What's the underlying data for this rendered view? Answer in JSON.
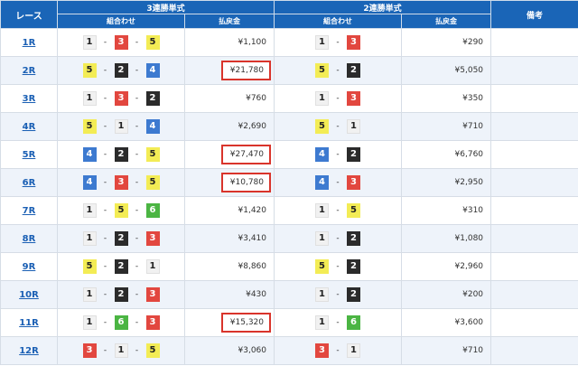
{
  "headers": {
    "race": "レース",
    "trifecta": "3連勝単式",
    "exacta": "2連勝単式",
    "note": "備考",
    "combo": "組合わせ",
    "payout": "払戻金"
  },
  "rows": [
    {
      "race": "1R",
      "tri": [
        "1",
        "3",
        "5"
      ],
      "tri_pay": "¥1,100",
      "tri_hl": false,
      "ex": [
        "1",
        "3"
      ],
      "ex_pay": "¥290"
    },
    {
      "race": "2R",
      "tri": [
        "5",
        "2",
        "4"
      ],
      "tri_pay": "¥21,780",
      "tri_hl": true,
      "ex": [
        "5",
        "2"
      ],
      "ex_pay": "¥5,050"
    },
    {
      "race": "3R",
      "tri": [
        "1",
        "3",
        "2"
      ],
      "tri_pay": "¥760",
      "tri_hl": false,
      "ex": [
        "1",
        "3"
      ],
      "ex_pay": "¥350"
    },
    {
      "race": "4R",
      "tri": [
        "5",
        "1",
        "4"
      ],
      "tri_pay": "¥2,690",
      "tri_hl": false,
      "ex": [
        "5",
        "1"
      ],
      "ex_pay": "¥710"
    },
    {
      "race": "5R",
      "tri": [
        "4",
        "2",
        "5"
      ],
      "tri_pay": "¥27,470",
      "tri_hl": true,
      "ex": [
        "4",
        "2"
      ],
      "ex_pay": "¥6,760"
    },
    {
      "race": "6R",
      "tri": [
        "4",
        "3",
        "5"
      ],
      "tri_pay": "¥10,780",
      "tri_hl": true,
      "ex": [
        "4",
        "3"
      ],
      "ex_pay": "¥2,950"
    },
    {
      "race": "7R",
      "tri": [
        "1",
        "5",
        "6"
      ],
      "tri_pay": "¥1,420",
      "tri_hl": false,
      "ex": [
        "1",
        "5"
      ],
      "ex_pay": "¥310"
    },
    {
      "race": "8R",
      "tri": [
        "1",
        "2",
        "3"
      ],
      "tri_pay": "¥3,410",
      "tri_hl": false,
      "ex": [
        "1",
        "2"
      ],
      "ex_pay": "¥1,080"
    },
    {
      "race": "9R",
      "tri": [
        "5",
        "2",
        "1"
      ],
      "tri_pay": "¥8,860",
      "tri_hl": false,
      "ex": [
        "5",
        "2"
      ],
      "ex_pay": "¥2,960"
    },
    {
      "race": "10R",
      "tri": [
        "1",
        "2",
        "3"
      ],
      "tri_pay": "¥430",
      "tri_hl": false,
      "ex": [
        "1",
        "2"
      ],
      "ex_pay": "¥200"
    },
    {
      "race": "11R",
      "tri": [
        "1",
        "6",
        "3"
      ],
      "tri_pay": "¥15,320",
      "tri_hl": true,
      "ex": [
        "1",
        "6"
      ],
      "ex_pay": "¥3,600"
    },
    {
      "race": "12R",
      "tri": [
        "3",
        "1",
        "5"
      ],
      "tri_pay": "¥3,060",
      "tri_hl": false,
      "ex": [
        "3",
        "1"
      ],
      "ex_pay": "¥710"
    }
  ],
  "colors": {
    "header_bg": "#1a65b7",
    "highlight_border": "#d9342b",
    "boat_1": "#f1f1f1",
    "boat_2": "#2b2b2b",
    "boat_3": "#e2473f",
    "boat_4": "#3d7ad0",
    "boat_5": "#f3ec55",
    "boat_6": "#4bb543"
  }
}
